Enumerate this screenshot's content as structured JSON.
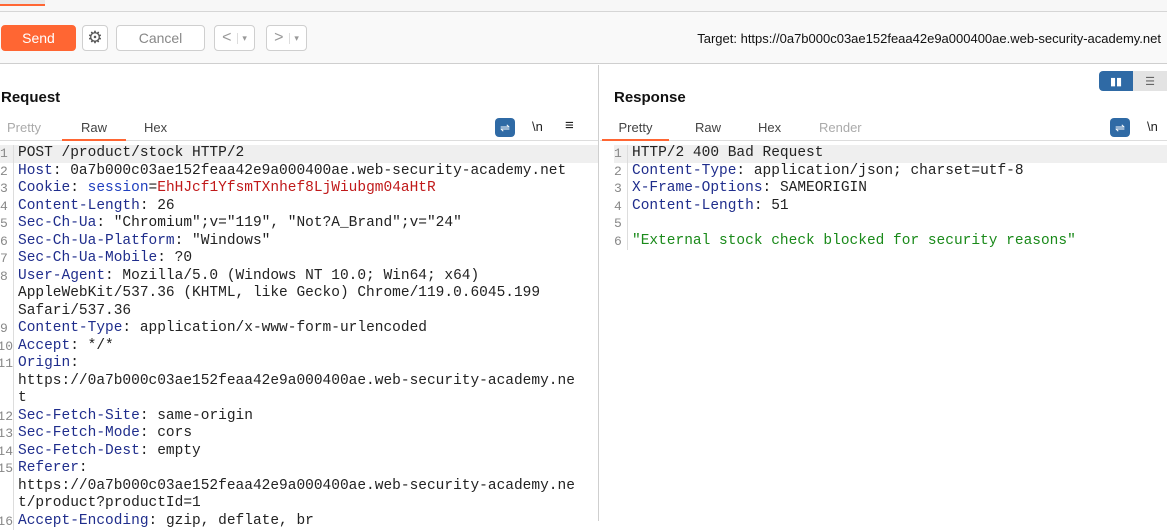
{
  "toolbar": {
    "send": "Send",
    "cancel": "Cancel",
    "back": "<",
    "forward": ">",
    "dropdown": "▾",
    "settings_icon": "gear-icon",
    "target": "Target: https://0a7b000c03ae152feaa42e9a000400ae.web-security-academy.net"
  },
  "request": {
    "title": "Request",
    "tabs": [
      "Pretty",
      "Raw",
      "Hex"
    ],
    "active_tab": "Raw",
    "newline_label": "\\n",
    "menu_label": "≡",
    "lines": [
      {
        "n": "1",
        "value": "POST /product/stock HTTP/2"
      },
      {
        "n": "2",
        "key": "Host",
        "value": "0a7b000c03ae152feaa42e9a000400ae.web-security-academy.net"
      },
      {
        "n": "3",
        "key": "Cookie",
        "param": "session",
        "pvalue": "EhHJcf1YfsmTXnhef8LjWiubgm04aHtR"
      },
      {
        "n": "4",
        "key": "Content-Length",
        "value": "26"
      },
      {
        "n": "5",
        "key": "Sec-Ch-Ua",
        "value": "\"Chromium\";v=\"119\", \"Not?A_Brand\";v=\"24\""
      },
      {
        "n": "6",
        "key": "Sec-Ch-Ua-Platform",
        "value": "\"Windows\""
      },
      {
        "n": "7",
        "key": "Sec-Ch-Ua-Mobile",
        "value": "?0"
      },
      {
        "n": "8",
        "key": "User-Agent",
        "value": "Mozilla/5.0 (Windows NT 10.0; Win64; x64)",
        "cont": [
          "AppleWebKit/537.36 (KHTML, like Gecko) Chrome/119.0.6045.199",
          "Safari/537.36"
        ]
      },
      {
        "n": "9",
        "key": "Content-Type",
        "value": "application/x-www-form-urlencoded"
      },
      {
        "n": "10",
        "key": "Accept",
        "value": "*/*"
      },
      {
        "n": "11",
        "key": "Origin",
        "value": "",
        "cont": [
          "https://0a7b000c03ae152feaa42e9a000400ae.web-security-academy.ne",
          "t"
        ]
      },
      {
        "n": "12",
        "key": "Sec-Fetch-Site",
        "value": "same-origin"
      },
      {
        "n": "13",
        "key": "Sec-Fetch-Mode",
        "value": "cors"
      },
      {
        "n": "14",
        "key": "Sec-Fetch-Dest",
        "value": "empty"
      },
      {
        "n": "15",
        "key": "Referer",
        "value": "",
        "cont": [
          "https://0a7b000c03ae152feaa42e9a000400ae.web-security-academy.ne",
          "t/product?productId=1"
        ]
      },
      {
        "n": "16",
        "key": "Accept-Encoding",
        "value": "gzip, deflate, br"
      }
    ]
  },
  "response": {
    "title": "Response",
    "tabs": [
      "Pretty",
      "Raw",
      "Hex",
      "Render"
    ],
    "active_tab": "Pretty",
    "newline_label": "\\n",
    "lines": [
      {
        "n": "1",
        "value": "HTTP/2 400 Bad Request"
      },
      {
        "n": "2",
        "key": "Content-Type",
        "value": "application/json; charset=utf-8"
      },
      {
        "n": "3",
        "key": "X-Frame-Options",
        "value": "SAMEORIGIN"
      },
      {
        "n": "4",
        "key": "Content-Length",
        "value": "51"
      },
      {
        "n": "5",
        "value": ""
      },
      {
        "n": "6",
        "str": "\"External stock check blocked for security reasons\""
      }
    ]
  }
}
